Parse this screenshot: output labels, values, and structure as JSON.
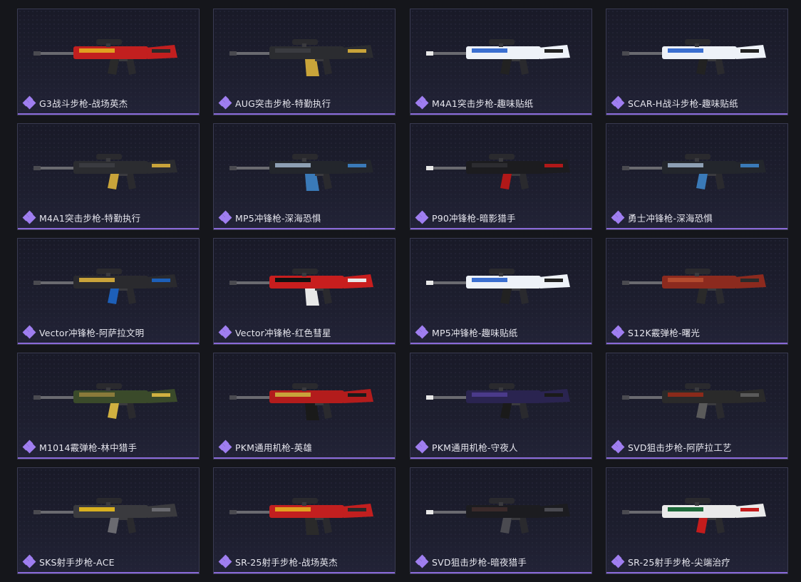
{
  "items": [
    {
      "label": "G3战斗步枪-战场英杰",
      "colors": [
        "#c21f1f",
        "#e0a020",
        "#2a2a2a"
      ]
    },
    {
      "label": "AUG突击步枪-特勤执行",
      "colors": [
        "#2b2c30",
        "#3a3b40",
        "#c9a43a"
      ]
    },
    {
      "label": "M4A1突击步枪-趣味贴纸",
      "colors": [
        "#eef2f8",
        "#3b6fd0",
        "#222"
      ]
    },
    {
      "label": "SCAR-H战斗步枪-趣味贴纸",
      "colors": [
        "#eef2f8",
        "#3b6fd0",
        "#222"
      ]
    },
    {
      "label": "M4A1突击步枪-特勤执行",
      "colors": [
        "#2b2c30",
        "#3a3b40",
        "#c9a43a"
      ]
    },
    {
      "label": "MP5冲锋枪-深海恐惧",
      "colors": [
        "#23262c",
        "#8ea0b4",
        "#3a7ab8"
      ]
    },
    {
      "label": "P90冲锋枪-暗影猎手",
      "colors": [
        "#1c1c1f",
        "#2c2c30",
        "#b01818"
      ]
    },
    {
      "label": "勇士冲锋枪-深海恐惧",
      "colors": [
        "#23262c",
        "#8ea0b4",
        "#3a7ab8"
      ]
    },
    {
      "label": "Vector冲锋枪-阿萨拉文明",
      "colors": [
        "#2a2a2e",
        "#c9a33a",
        "#1d5fb8"
      ]
    },
    {
      "label": "Vector冲锋枪-红色彗星",
      "colors": [
        "#c81e1e",
        "#111",
        "#e8e8e8"
      ]
    },
    {
      "label": "MP5冲锋枪-趣味贴纸",
      "colors": [
        "#eef2f8",
        "#3b6fd0",
        "#222"
      ]
    },
    {
      "label": "S12K霰弹枪-曙光",
      "colors": [
        "#8c2a1e",
        "#b34a2e",
        "#2a2a2a"
      ]
    },
    {
      "label": "M1014霰弹枪-林中猎手",
      "colors": [
        "#3a4a2a",
        "#8a7a3a",
        "#d0b040"
      ]
    },
    {
      "label": "PKM通用机枪-英雄",
      "colors": [
        "#b31c1c",
        "#c9a33a",
        "#1a1a1a"
      ]
    },
    {
      "label": "PKM通用机枪-守夜人",
      "colors": [
        "#2a2450",
        "#4a3a8a",
        "#1a1a1a"
      ]
    },
    {
      "label": "SVD狙击步枪-阿萨拉工艺",
      "colors": [
        "#2a2a2a",
        "#8a2a1a",
        "#5a5a5a"
      ]
    },
    {
      "label": "SKS射手步枪-ACE",
      "colors": [
        "#3a3a3e",
        "#d8b020",
        "#6a6a70"
      ]
    },
    {
      "label": "SR-25射手步枪-战场英杰",
      "colors": [
        "#c21f1f",
        "#e0a020",
        "#2a2a2a"
      ]
    },
    {
      "label": "SVD狙击步枪-暗夜猎手",
      "colors": [
        "#1c1c20",
        "#3a2a2a",
        "#4a4a50"
      ]
    },
    {
      "label": "SR-25射手步枪-尖端治疗",
      "colors": [
        "#eaeaea",
        "#1e6a3a",
        "#c41c1c"
      ]
    }
  ],
  "rarity_color": "#9f7ef0",
  "icons": {
    "rarity": "diamond-cluster-icon",
    "weapon": "weapon-image"
  }
}
